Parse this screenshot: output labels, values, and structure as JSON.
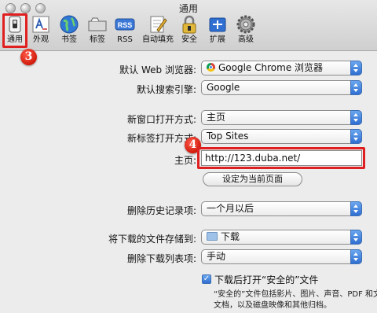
{
  "window": {
    "title": "通用"
  },
  "toolbar": {
    "items": [
      {
        "label": "通用",
        "icon": "switch-icon"
      },
      {
        "label": "外观",
        "icon": "font-icon"
      },
      {
        "label": "书签",
        "icon": "globe-icon"
      },
      {
        "label": "标签",
        "icon": "tabs-icon"
      },
      {
        "label": "RSS",
        "icon": "rss-icon"
      },
      {
        "label": "自动填充",
        "icon": "pencil-icon"
      },
      {
        "label": "安全",
        "icon": "lock-icon"
      },
      {
        "label": "扩展",
        "icon": "puzzle-icon"
      },
      {
        "label": "高级",
        "icon": "gear-icon"
      }
    ]
  },
  "settings": {
    "default_browser": {
      "label": "默认 Web 浏览器:",
      "value": "Google Chrome 浏览器"
    },
    "default_search": {
      "label": "默认搜索引擎:",
      "value": "Google"
    },
    "new_window": {
      "label": "新窗口打开方式:",
      "value": "主页"
    },
    "new_tab": {
      "label": "新标签打开方式:",
      "value": "Top Sites"
    },
    "homepage": {
      "label": "主页:",
      "value": "http://123.duba.net/"
    },
    "set_current_button": "设定为当前页面",
    "remove_history": {
      "label": "删除历史记录项:",
      "value": "一个月以后"
    },
    "save_downloads": {
      "label": "将下载的文件存储到:",
      "value": "下载"
    },
    "remove_downloads": {
      "label": "删除下载列表项:",
      "value": "手动"
    },
    "open_safe_files": {
      "label": "下载后打开“安全的”文件",
      "checked": true,
      "note_line1": "“安全的”文件包括影片、图片、声音、PDF 和文本",
      "note_line2": "文档，以及磁盘映像和其他归档。"
    }
  },
  "annotations": {
    "step3": "3",
    "step4": "4"
  },
  "colors": {
    "highlight": "#e02020",
    "accent": "#2f6fd1"
  }
}
